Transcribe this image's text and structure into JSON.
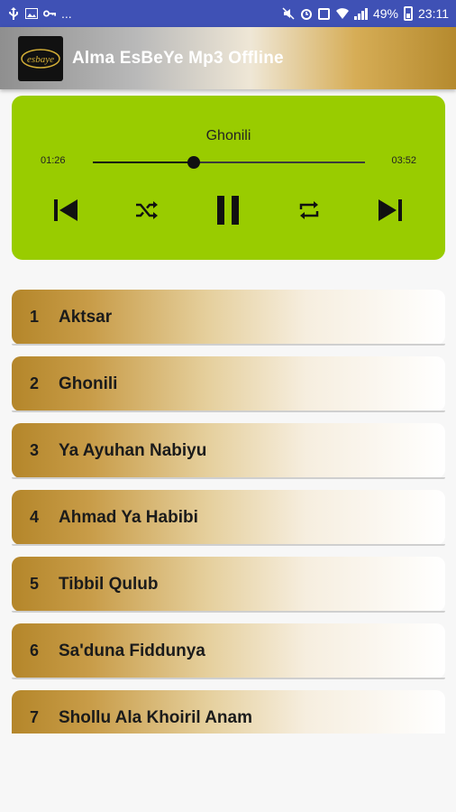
{
  "status_bar": {
    "left_text": "...",
    "battery": "49%",
    "time": "23:11"
  },
  "app": {
    "title": "Alma EsBeYe Mp3 Offline",
    "logo_text": "esbaye"
  },
  "player": {
    "track_title": "Ghonili",
    "current_time": "01:26",
    "total_time": "03:52",
    "progress_fraction": 0.37
  },
  "playlist": [
    {
      "num": "1",
      "title": "Aktsar"
    },
    {
      "num": "2",
      "title": "Ghonili"
    },
    {
      "num": "3",
      "title": "Ya Ayuhan Nabiyu"
    },
    {
      "num": "4",
      "title": "Ahmad Ya Habibi"
    },
    {
      "num": "5",
      "title": "Tibbil Qulub"
    },
    {
      "num": "6",
      "title": "Sa'duna Fiddunya"
    },
    {
      "num": "7",
      "title": "Shollu Ala Khoiril Anam"
    }
  ],
  "colors": {
    "status_bar": "#3f51b5",
    "player_bg": "#99cc00",
    "item_gold": "#b4862a"
  }
}
